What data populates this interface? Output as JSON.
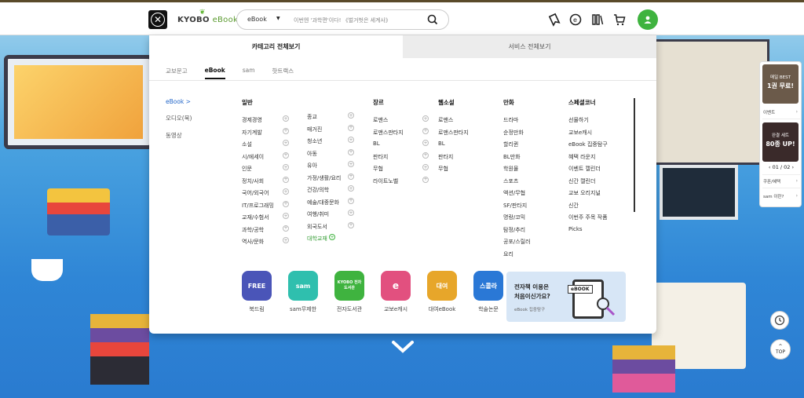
{
  "header": {
    "logo_text": "KYOBO",
    "logo_sub": "eBook",
    "search_select": "eBook",
    "search_placeholder": "이번엔 '과학편'이다! 《벌거벗은 세계사》"
  },
  "panel": {
    "tabs": [
      "카테고리 전체보기",
      "서비스 전체보기"
    ],
    "subtabs": [
      "교보문고",
      "eBook",
      "sam",
      "핫트랙스"
    ],
    "left_nav": [
      "eBook  >",
      "오디오(북)",
      "동영상"
    ],
    "general": {
      "heading": "일반",
      "col1": [
        "경제경영",
        "자기계발",
        "소설",
        "시/에세이",
        "인문",
        "정치/사회",
        "국어/외국어",
        "IT/프로그래밍",
        "교재/수험서",
        "과학/공학",
        "역사/문화"
      ],
      "col2": [
        "종교",
        "매거진",
        "청소년",
        "아동",
        "유아",
        "가정/생활/요리",
        "건강/의학",
        "예술/대중문화",
        "여행/취미",
        "외국도서",
        "대학교재"
      ]
    },
    "genre": {
      "heading": "장르",
      "items": [
        "로맨스",
        "로맨스판타지",
        "BL",
        "판타지",
        "무협",
        "라이트노벨"
      ]
    },
    "webnovel": {
      "heading": "웹소설",
      "items": [
        "로맨스",
        "로맨스판타지",
        "BL",
        "판타지",
        "무협"
      ]
    },
    "comics": {
      "heading": "만화",
      "items": [
        "드라마",
        "순정만화",
        "할리퀸",
        "BL만화",
        "학원물",
        "스포츠",
        "액션/무협",
        "SF/판타지",
        "명랑/코믹",
        "탐정/추리",
        "공포/스릴러",
        "요리"
      ]
    },
    "special": {
      "heading": "스페셜코너",
      "items": [
        "선물하기",
        "교보e캐시",
        "eBook 집중탐구",
        "혜택 라운지",
        "이벤트 캘린더",
        "신간 캘린더",
        "교보 오리지널",
        "신간",
        "이번주 주목 작품",
        "Picks"
      ]
    },
    "quicklinks": [
      {
        "label": "북드림",
        "icon": "FREE"
      },
      {
        "label": "sam무제한",
        "icon": "sam"
      },
      {
        "label": "전자도서관",
        "icon": "KYOBO 전자도서관"
      },
      {
        "label": "교보e캐시",
        "icon": "e"
      },
      {
        "label": "대여eBook",
        "icon": "대여"
      },
      {
        "label": "학술논문",
        "icon": "스콜라"
      }
    ],
    "promo": {
      "title_line1": "전자책 이용은",
      "title_line2": "처음이신가요?",
      "sub": "eBook 집중탐구",
      "device": "eBOOK"
    }
  },
  "side_widget": {
    "banner1_line1": "매일 BEST",
    "banner1_line2": "1권 무료!",
    "link_event": "이벤트",
    "banner2_line1": "완결 세트",
    "banner2_line2": "80종 UP!",
    "page": "01 / 02",
    "link_coupon": "쿠폰/혜택",
    "link_sam": "sam 이란?"
  },
  "top_label": "TOP",
  "colors": {
    "accent_green": "#3fb33f",
    "link_blue": "#2467c9"
  }
}
